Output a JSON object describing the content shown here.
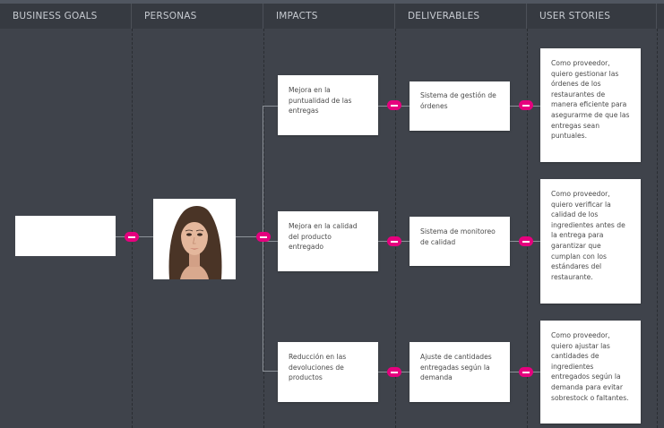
{
  "columns": [
    "BUSINESS GOALS",
    "PERSONAS",
    "IMPACTS",
    "DELIVERABLES",
    "USER STORIES"
  ],
  "business_goal": {
    "text": ""
  },
  "persona": {
    "avatar": "woman-portrait"
  },
  "impacts": [
    "Mejora en la puntualidad de las entregas",
    "Mejora en la calidad del producto entregado",
    "Reducción en las devoluciones de productos"
  ],
  "deliverables": [
    "Sistema de gestión de órdenes",
    "Sistema de monitoreo de calidad",
    "Ajuste de cantidades entregadas según la demanda"
  ],
  "user_stories": [
    "Como proveedor, quiero gestionar las órdenes de los restaurantes de manera eficiente para asegurarme de que las entregas sean puntuales.",
    "Como proveedor, quiero verificar la calidad de los ingredientes antes de la entrega para garantizar que cumplan con los estándares del restaurante.",
    "Como proveedor, quiero ajustar las cantidades de ingredientes entregados según la demanda para evitar sobrestock o faltantes."
  ],
  "colors": {
    "background": "#3f434b",
    "header": "#363a41",
    "accent": "#e6007e",
    "connector": "#8e939a"
  }
}
